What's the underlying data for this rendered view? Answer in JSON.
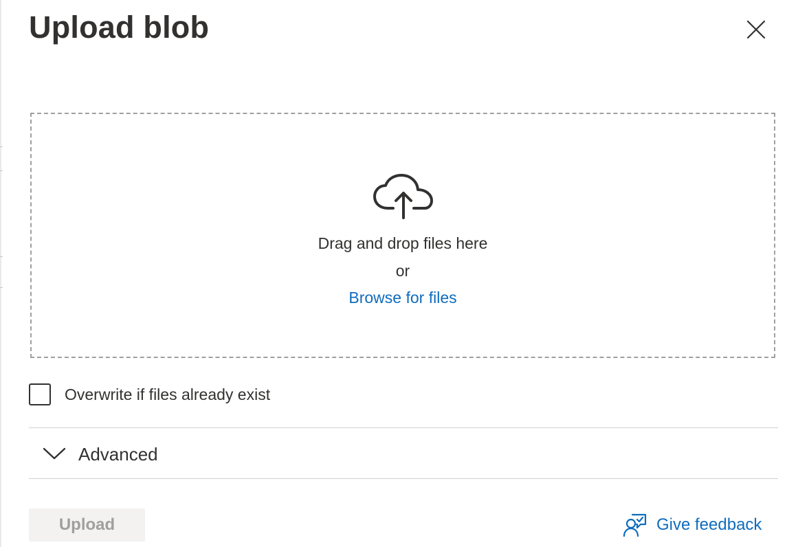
{
  "panel": {
    "title": "Upload blob",
    "close_icon": "close-icon"
  },
  "dropzone": {
    "icon": "cloud-upload-icon",
    "drag_text": "Drag and drop files here",
    "or_text": "or",
    "browse_label": "Browse for files"
  },
  "overwrite": {
    "label": "Overwrite if files already exist",
    "checked": false
  },
  "advanced": {
    "label": "Advanced",
    "icon": "chevron-down-icon",
    "expanded": false
  },
  "footer": {
    "upload_label": "Upload",
    "upload_enabled": false,
    "feedback_icon": "feedback-person-icon",
    "feedback_label": "Give feedback"
  },
  "colors": {
    "link": "#0f6cbd",
    "text": "#323130",
    "disabled_bg": "#f3f2f1",
    "disabled_text": "#a19f9d",
    "border": "#a19f9d"
  }
}
